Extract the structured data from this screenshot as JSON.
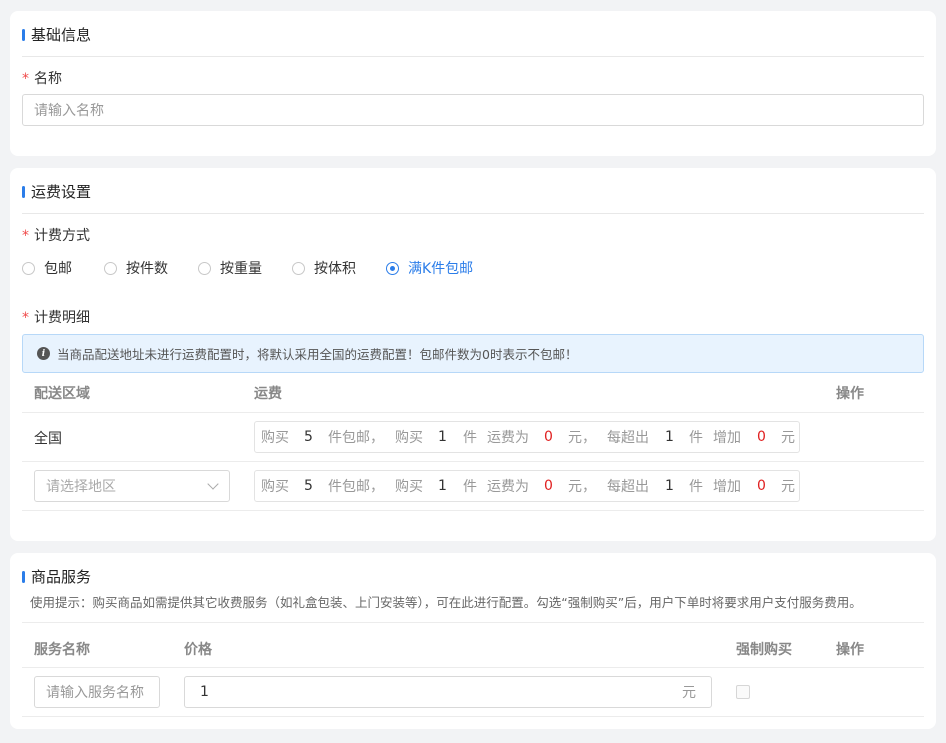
{
  "basic": {
    "title": "基础信息",
    "name_label": "名称",
    "name_placeholder": "请输入名称"
  },
  "freight": {
    "title": "运费设置",
    "method_label": "计费方式",
    "methods": [
      "包邮",
      "按件数",
      "按重量",
      "按体积",
      "满K件包邮"
    ],
    "selected_method": "满K件包邮",
    "detail_label": "计费明细",
    "alert": "当商品配送地址未进行运费配置时，将默认采用全国的运费配置！包邮件数为0时表示不包邮！",
    "columns": [
      "配送区域",
      "运费",
      "操作"
    ],
    "rows": [
      {
        "region": "全国",
        "buy1": "购买",
        "free_qty": "5",
        "free_unit": "件包邮，",
        "buy2": "购买",
        "qty": "1",
        "qty_unit": "件",
        "fee_label": "运费为",
        "fee": "0",
        "fee_unit": "元，",
        "each_label": "每超出",
        "over_qty": "1",
        "over_unit": "件",
        "add_label": "增加",
        "add_fee": "0",
        "add_unit": "元"
      },
      {
        "region_placeholder": "请选择地区",
        "buy1": "购买",
        "free_qty": "5",
        "free_unit": "件包邮，",
        "buy2": "购买",
        "qty": "1",
        "qty_unit": "件",
        "fee_label": "运费为",
        "fee": "0",
        "fee_unit": "元，",
        "each_label": "每超出",
        "over_qty": "1",
        "over_unit": "件",
        "add_label": "增加",
        "add_fee": "0",
        "add_unit": "元"
      }
    ]
  },
  "service": {
    "title": "商品服务",
    "tip": "使用提示：购买商品如需提供其它收费服务（如礼盒包装、上门安装等），可在此进行配置。勾选“强制购买”后，用户下单时将要求用户支付服务费用。",
    "columns": [
      "服务名称",
      "价格",
      "强制购买",
      "操作"
    ],
    "row": {
      "name_placeholder": "请输入服务名称",
      "price": "1",
      "price_unit": "元",
      "forced": false
    }
  },
  "colors": {
    "accent": "#2b7de9",
    "required": "#f04a4a",
    "red_value": "#e02020",
    "alert_bg": "#e8f3fe"
  }
}
